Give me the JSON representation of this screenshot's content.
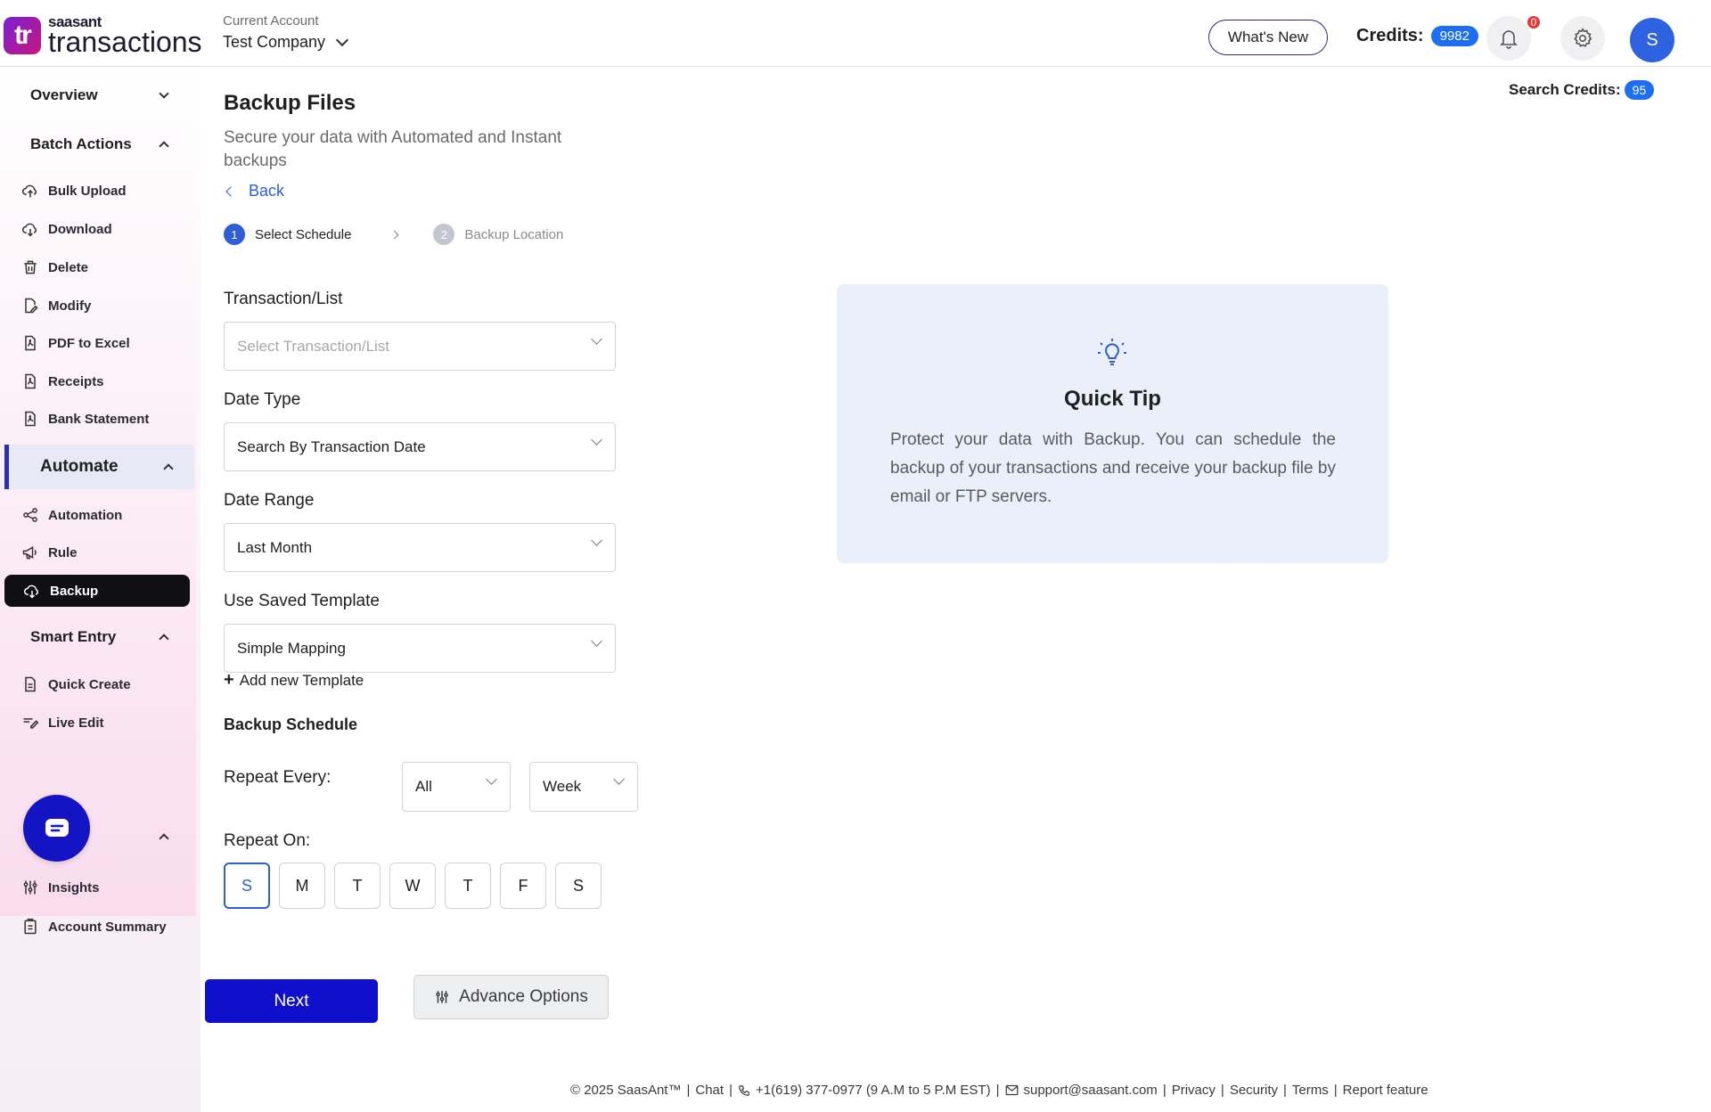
{
  "header": {
    "logo_mark": "tr",
    "logo_brand": "saasant",
    "logo_product": "transactions",
    "account_label": "Current Account",
    "account_value": "Test Company",
    "whats_new": "What's New",
    "credits_label": "Credits:",
    "credits_value": "9982",
    "notifications_count": "0",
    "avatar_initial": "S",
    "search_credits_label": "Search Credits:",
    "search_credits_value": "95"
  },
  "sidebar": {
    "overview": "Overview",
    "batch_actions": "Batch Actions",
    "batch_items": [
      "Bulk Upload",
      "Download",
      "Delete",
      "Modify",
      "PDF to Excel",
      "Receipts",
      "Bank Statement"
    ],
    "automate": "Automate",
    "automate_items": [
      "Automation",
      "Rule",
      "Backup"
    ],
    "smart_entry": "Smart Entry",
    "smart_items": [
      "Quick Create",
      "Live Edit"
    ],
    "report_items": [
      "Insights",
      "Account Summary"
    ]
  },
  "main": {
    "title": "Backup Files",
    "subtitle": "Secure your data with Automated and Instant backups",
    "back": "Back",
    "steps": [
      {
        "num": "1",
        "label": "Select Schedule"
      },
      {
        "num": "2",
        "label": "Backup Location"
      }
    ],
    "transaction_label": "Transaction/List",
    "transaction_placeholder": "Select Transaction/List",
    "date_type_label": "Date Type",
    "date_type_value": "Search By Transaction Date",
    "date_range_label": "Date Range",
    "date_range_value": "Last Month",
    "template_label": "Use Saved Template",
    "template_value": "Simple Mapping",
    "add_template": "Add new Template",
    "backup_schedule": "Backup Schedule",
    "repeat_every_label": "Repeat Every:",
    "repeat_every_count": "All",
    "repeat_every_unit": "Week",
    "repeat_on_label": "Repeat On:",
    "days": [
      "S",
      "M",
      "T",
      "W",
      "T",
      "F",
      "S"
    ],
    "next": "Next",
    "advance_options": "Advance Options"
  },
  "tip": {
    "title": "Quick Tip",
    "text": "Protect your data with Backup. You can schedule the backup of your transactions and receive your backup file by email or FTP servers."
  },
  "footer": {
    "copyright": "© 2025 SaasAnt™",
    "chat": "Chat",
    "phone": "+1(619) 377-0977 (9 A.M to 5 P.M EST)",
    "email": "support@saasant.com",
    "privacy": "Privacy",
    "security": "Security",
    "terms": "Terms",
    "report": "Report feature"
  },
  "colors": {
    "accent": "#1010cc",
    "link": "#2d5ed6",
    "badge": "#1d6ef0",
    "tip_bg": "#ebeffa"
  }
}
